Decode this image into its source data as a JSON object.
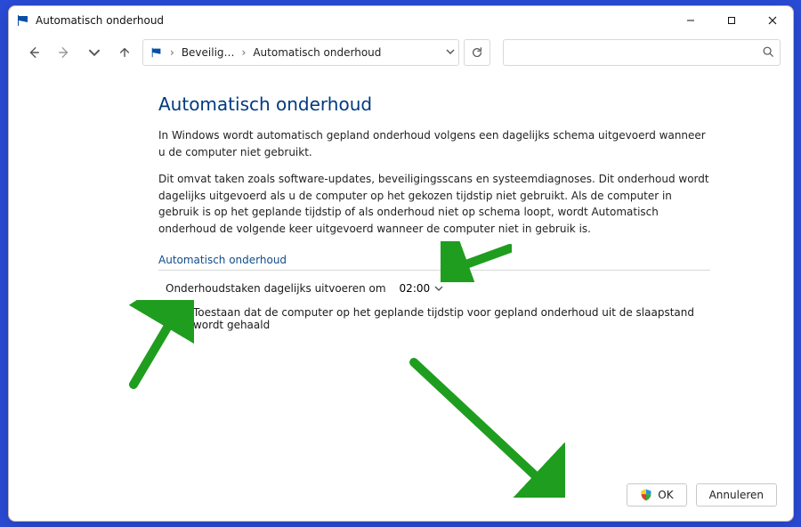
{
  "window": {
    "title": "Automatisch onderhoud"
  },
  "breadcrumb": {
    "item1": "Beveilig…",
    "item2": "Automatisch onderhoud"
  },
  "search": {
    "placeholder": ""
  },
  "page": {
    "heading": "Automatisch onderhoud",
    "para1": "In Windows wordt automatisch gepland onderhoud volgens een dagelijks schema uitgevoerd wanneer u de computer niet gebruikt.",
    "para2": "Dit omvat taken zoals software-updates, beveiligingsscans en systeemdiagnoses. Dit onderhoud wordt dagelijks uitgevoerd als u de computer op het gekozen tijdstip niet gebruikt. Als de computer in gebruik is op het geplande tijdstip of als onderhoud niet op schema loopt, wordt Automatisch onderhoud de volgende keer uitgevoerd wanneer de computer niet in gebruik is.",
    "section_label": "Automatisch onderhoud",
    "time_label": "Onderhoudstaken dagelijks uitvoeren om",
    "time_value": "02:00",
    "wake_label": "Toestaan dat de computer op het geplande tijdstip voor gepland onderhoud uit de slaapstand wordt gehaald"
  },
  "footer": {
    "ok": "OK",
    "cancel": "Annuleren"
  }
}
